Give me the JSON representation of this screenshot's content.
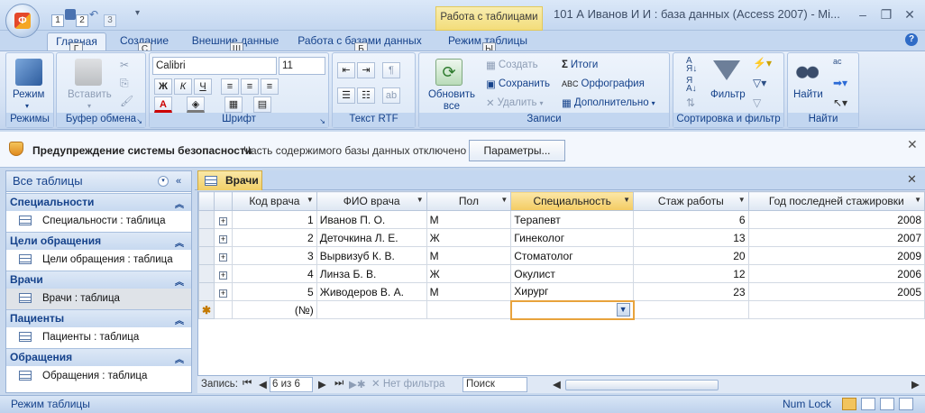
{
  "qat": {
    "keys": [
      "1",
      "2",
      "3"
    ]
  },
  "title": {
    "context_tab": "Работа с таблицами",
    "window": "101 А Иванов И И : база данных (Access 2007) - Mi..."
  },
  "tabs": [
    {
      "label": "Главная",
      "key": "Г"
    },
    {
      "label": "Создание",
      "key": "С"
    },
    {
      "label": "Внешние данные",
      "key": "Ш"
    },
    {
      "label": "Работа с базами данных",
      "key": "Б"
    },
    {
      "label": "Режим таблицы",
      "key": "Ы"
    }
  ],
  "ribbon": {
    "views": {
      "mode_label": "Режим",
      "group": "Режимы"
    },
    "clipboard": {
      "paste_label": "Вставить",
      "group": "Буфер обмена"
    },
    "font": {
      "font_name": "Calibri",
      "font_size": "11",
      "group": "Шрифт"
    },
    "rtf": {
      "group": "Текст RTF"
    },
    "records": {
      "refresh_label": "Обновить все",
      "create": "Создать",
      "save": "Сохранить",
      "delete": "Удалить",
      "totals": "Итоги",
      "spelling": "Орфография",
      "more": "Дополнительно",
      "group": "Записи"
    },
    "sort": {
      "filter_label": "Фильтр",
      "group": "Сортировка и фильтр"
    },
    "find": {
      "find_label": "Найти",
      "group": "Найти"
    }
  },
  "security": {
    "title": "Предупреждение системы безопасности",
    "message": "Часть содержимого базы данных отключено",
    "button": "Параметры..."
  },
  "nav": {
    "header": "Все таблицы",
    "groups": [
      {
        "name": "Специальности",
        "item": "Специальности : таблица"
      },
      {
        "name": "Цели обращения",
        "item": "Цели обращения : таблица"
      },
      {
        "name": "Врачи",
        "item": "Врачи : таблица"
      },
      {
        "name": "Пациенты",
        "item": "Пациенты : таблица"
      },
      {
        "name": "Обращения",
        "item": "Обращения : таблица"
      }
    ]
  },
  "doc": {
    "tab": "Врачи"
  },
  "table": {
    "columns": [
      "Код врача",
      "ФИО врача",
      "Пол",
      "Специальность",
      "Стаж работы",
      "Год последней стажировки"
    ],
    "rows": [
      [
        "1",
        "Иванов П. О.",
        "М",
        "Терапевт",
        "6",
        "2008"
      ],
      [
        "2",
        "Деточкина Л. Е.",
        "Ж",
        "Гинеколог",
        "13",
        "2007"
      ],
      [
        "3",
        "Вырвизуб К. В.",
        "М",
        "Стоматолог",
        "20",
        "2009"
      ],
      [
        "4",
        "Линза Б. В.",
        "Ж",
        "Окулист",
        "12",
        "2006"
      ],
      [
        "5",
        "Живодеров В. А.",
        "М",
        "Хирург",
        "23",
        "2005"
      ]
    ],
    "new_row_counter": "(№)"
  },
  "recnav": {
    "label": "Запись:",
    "position": "6 из 6",
    "filter": "Нет фильтра",
    "search": "Поиск"
  },
  "status": {
    "mode": "Режим таблицы",
    "numlock": "Num Lock"
  }
}
